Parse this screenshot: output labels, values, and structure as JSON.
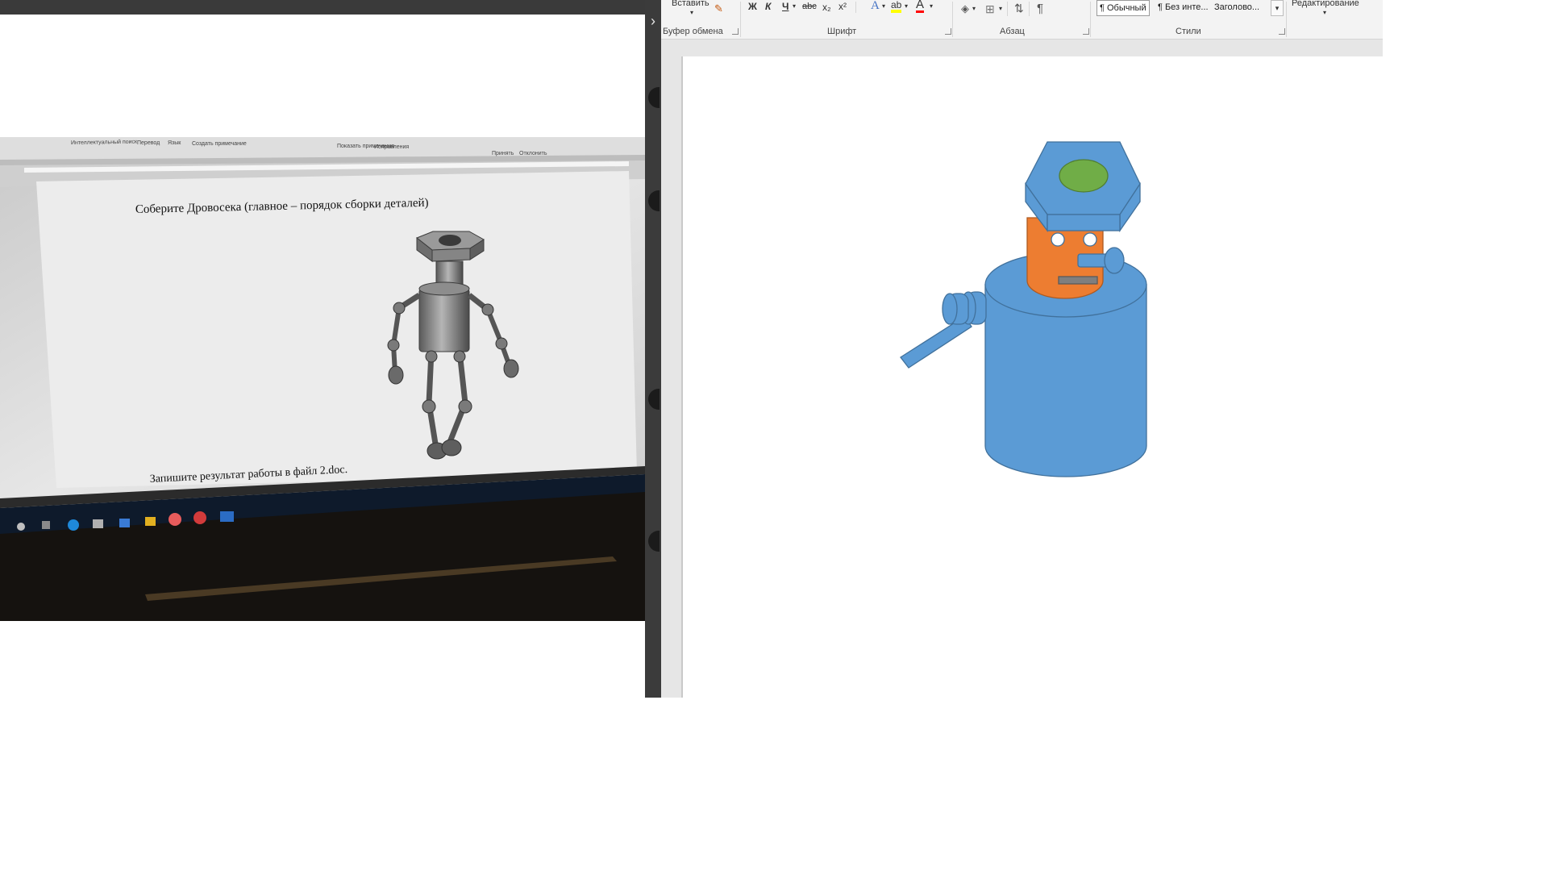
{
  "photo": {
    "heading": "Соберите Дровосека (главное – порядок сборки деталей)",
    "footer_text": "Запишите результат работы в файл 2.doc.",
    "ribbon_items": [
      "Интеллектуальный поиск",
      "Перевод",
      "Язык",
      "Создать примечание",
      "Показать примечания",
      "Исправления",
      "Принять",
      "Отклонить"
    ]
  },
  "ribbon": {
    "clipboard": {
      "paste_label": "Вставить",
      "group_label": "Буфер обмена"
    },
    "font": {
      "bold": "Ж",
      "italic": "К",
      "underline": "Ч",
      "strike": "abc",
      "subscript": "x₂",
      "superscript": "x²",
      "text_effects": "A",
      "highlight": "ab",
      "font_color": "A",
      "group_label": "Шрифт"
    },
    "paragraph": {
      "group_label": "Абзац",
      "pilcrow": "¶"
    },
    "styles": {
      "items": [
        "¶ Обычный",
        "¶ Без инте...",
        "Заголово..."
      ],
      "group_label": "Стили"
    },
    "editing": {
      "label": "Редактирование"
    }
  },
  "colors": {
    "robot_blue": "#5b9bd5",
    "robot_blue_stroke": "#41719c",
    "face_orange": "#ed7d31",
    "bolt_green": "#70ad47",
    "mouth_gray": "#7f7f7f"
  },
  "icons": {
    "divider_chevron": "chevron-right-icon",
    "format_painter": "format-painter-icon",
    "sort": "sort-icon",
    "borders": "borders-icon",
    "shading": "shading-icon",
    "styles_more": "chevron-down-icon"
  }
}
